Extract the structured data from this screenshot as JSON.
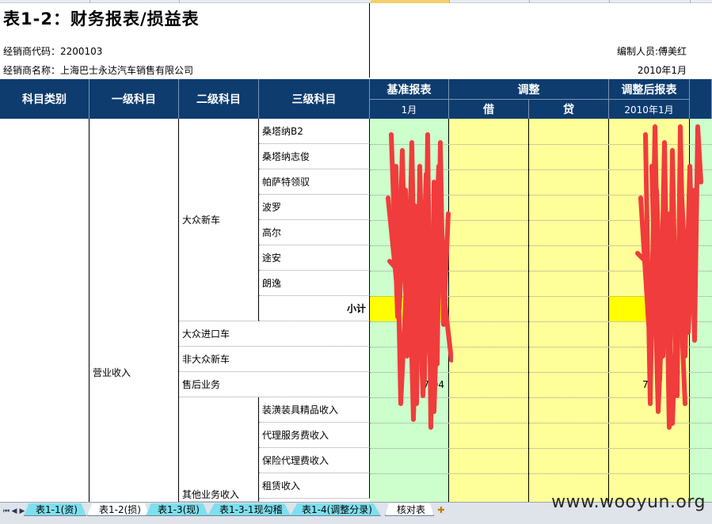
{
  "sheet": {
    "title": "表1-2：财务报表/损益表",
    "dealer_code": "经销商代码：2200103",
    "dealer_name": "经销商名称：上海巴士永达汽车销售有限公司",
    "editor": "编制人员:傅美红",
    "period": "2010年1月"
  },
  "header": {
    "col_category": "科目类别",
    "col_level1": "一级科目",
    "col_level2": "二级科目",
    "col_level3": "三级科目",
    "base_report": "基准报表",
    "base_month": "1月",
    "adjust": "调整",
    "debit": "借",
    "credit": "贷",
    "adjusted_report": "调整后报表",
    "adjusted_month": "2010年1月"
  },
  "rows": {
    "level1_revenue": "营业收入",
    "vw_new_car": "大众新车",
    "vw_items": [
      "桑塔纳B2",
      "桑塔纳志俊",
      "帕萨特领驭",
      "波罗",
      "高尔",
      "途安",
      "朗逸"
    ],
    "subtotal": "小计",
    "vw_import": "大众进口车",
    "non_vw_new": "非大众新车",
    "after_sales": "售后业务",
    "after_sales_base": "7    04",
    "after_sales_adj": "7",
    "other_business": "其他业务收入",
    "other_items": [
      "装潢装具精品收入",
      "代理服务费收入",
      "保险代理费收入",
      "租赁收入"
    ]
  },
  "tabs": [
    {
      "label": "表1-1(资)"
    },
    {
      "label": "表1-2(损)"
    },
    {
      "label": "表1-3(现)"
    },
    {
      "label": "表1-3-1现勾稽"
    },
    {
      "label": "表1-4(调整分录)"
    },
    {
      "label": "核对表"
    }
  ],
  "watermark": "www.wooyun.org",
  "colors": {
    "header_bg": "#0e3c6e",
    "base_col": "#ccffcc",
    "adjust_col": "#ffff99",
    "subtotal_highlight": "#ffff00",
    "redaction": "#f03c3c"
  }
}
